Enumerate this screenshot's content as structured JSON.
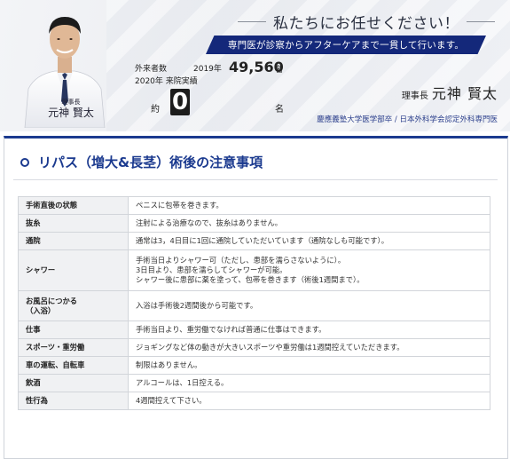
{
  "banner": {
    "headline": "私たちにお任せください！",
    "subheadline": "専門医が診察からアフターケアまで一貫して行います。",
    "doctor_caption_title": "理事長",
    "doctor_caption_name": "元神 賢太",
    "stats": {
      "outpatients_label": "外来者数",
      "outpatients_year": "2019年",
      "outpatients_value": "49,560",
      "outpatients_unit": "名",
      "visits_label": "2020年 来院実績",
      "approx": "約",
      "visits_value": "0",
      "visits_unit": "名"
    },
    "director": {
      "role": "理事長",
      "name": "元神 賢太",
      "credentials": "慶應義塾大学医学部卒 / 日本外科学会認定外科専門医"
    }
  },
  "section": {
    "title": "リパス（増大&長茎）術後の注意事項"
  },
  "care_table": [
    {
      "key": "手術直後の状態",
      "value": "ペニスに包帯を巻きます。"
    },
    {
      "key": "抜糸",
      "value": "注射による治療なので、抜糸はありません。"
    },
    {
      "key": "通院",
      "value": "通常は3，4日目に1回に通院していただいています（通院なしも可能です）。"
    },
    {
      "key": "シャワー",
      "value": "手術当日よりシャワー可（ただし、患部を濡らさないように）。\n3日目より、患部を濡らしてシャワーが可能。\nシャワー後に患部に薬を塗って、包帯を巻きます（術後1週間まで）。"
    },
    {
      "key": "お風呂につかる\n（入浴）",
      "value": "入浴は手術後2週間後から可能です。"
    },
    {
      "key": "仕事",
      "value": "手術当日より、重労働でなければ普通に仕事はできます。"
    },
    {
      "key": "スポーツ・重労働",
      "value": "ジョギングなど体の動きが大きいスポーツや重労働は1週間控えていただきます。"
    },
    {
      "key": "車の運転、自転車",
      "value": "制限はありません。"
    },
    {
      "key": "飲酒",
      "value": "アルコールは、1日控える。"
    },
    {
      "key": "性行為",
      "value": "4週間控えて下さい。"
    }
  ],
  "colors": {
    "brand_navy": "#1b3a8f",
    "subbar_navy": "#14287a",
    "table_key_bg": "#f0f1f3"
  }
}
